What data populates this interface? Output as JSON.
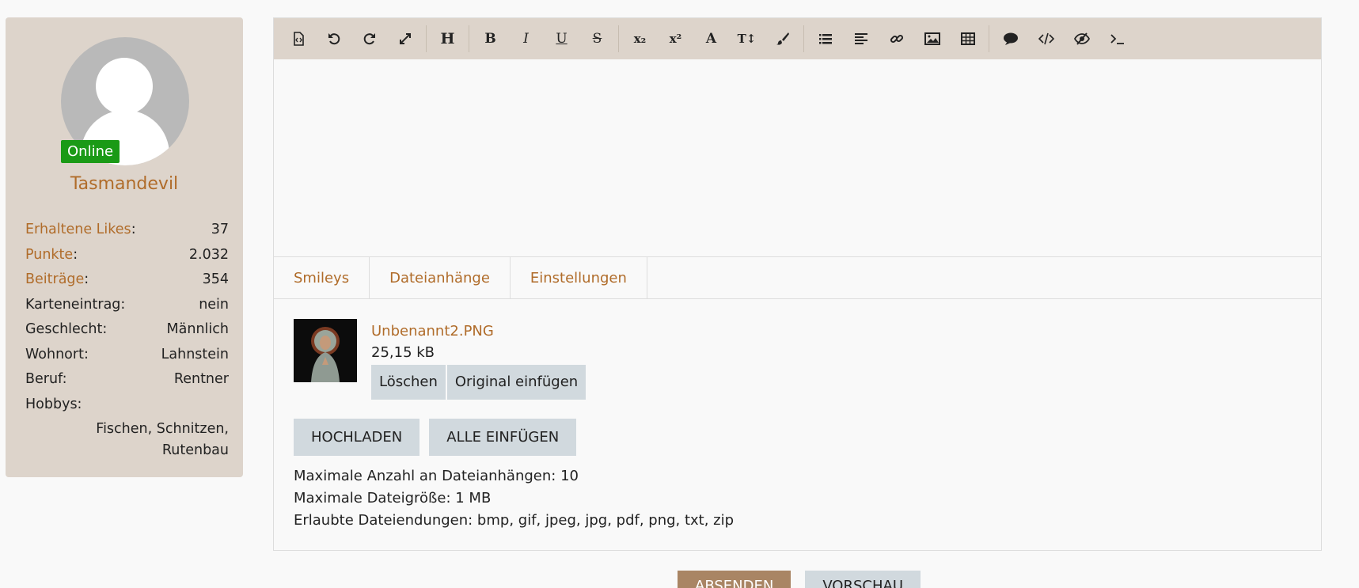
{
  "profile": {
    "status": "Online",
    "username": "Tasmandevil",
    "stats": [
      {
        "label": "Erhaltene Likes",
        "link": true,
        "value": "37"
      },
      {
        "label": "Punkte",
        "link": true,
        "value": "2.032"
      },
      {
        "label": "Beiträge",
        "link": true,
        "value": "354"
      },
      {
        "label": "Karteneintrag",
        "link": false,
        "value": "nein"
      },
      {
        "label": "Geschlecht",
        "link": false,
        "value": "Männlich"
      },
      {
        "label": "Wohnort",
        "link": false,
        "value": "Lahnstein"
      },
      {
        "label": "Beruf",
        "link": false,
        "value": "Rentner"
      }
    ],
    "hobbies_label": "Hobbys:",
    "hobbies_line1": "Fischen, Schnitzen,",
    "hobbies_line2": "Rutenbau"
  },
  "toolbar": {
    "heading": "H",
    "bold": "B",
    "italic": "I",
    "underline": "U",
    "strike": "S",
    "subscript": "x₂",
    "superscript": "x²",
    "font": "A",
    "font_size": "T↕"
  },
  "tabs": [
    "Smileys",
    "Dateianhänge",
    "Einstellungen"
  ],
  "attachment": {
    "filename": "Unbenannt2.PNG",
    "size": "25,15 kB",
    "delete_label": "Löschen",
    "insert_original_label": "Original einfügen"
  },
  "upload": {
    "upload_label": "HOCHLADEN",
    "insert_all_label": "ALLE EINFÜGEN"
  },
  "info": {
    "max_count": "Maximale Anzahl an Dateianhängen: 10",
    "max_size": "Maximale Dateigröße: 1 MB",
    "allowed": "Erlaubte Dateiendungen: bmp, gif, jpeg, jpg, pdf, png, txt, zip"
  },
  "actions": {
    "submit": "ABSENDEN",
    "preview": "VORSCHAU"
  },
  "colors": {
    "accent": "#b06c2a",
    "sidebar_bg": "#ddd4cb",
    "online": "#1a9a16",
    "button_bg": "#d1d9de",
    "submit_bg": "#a98564"
  }
}
